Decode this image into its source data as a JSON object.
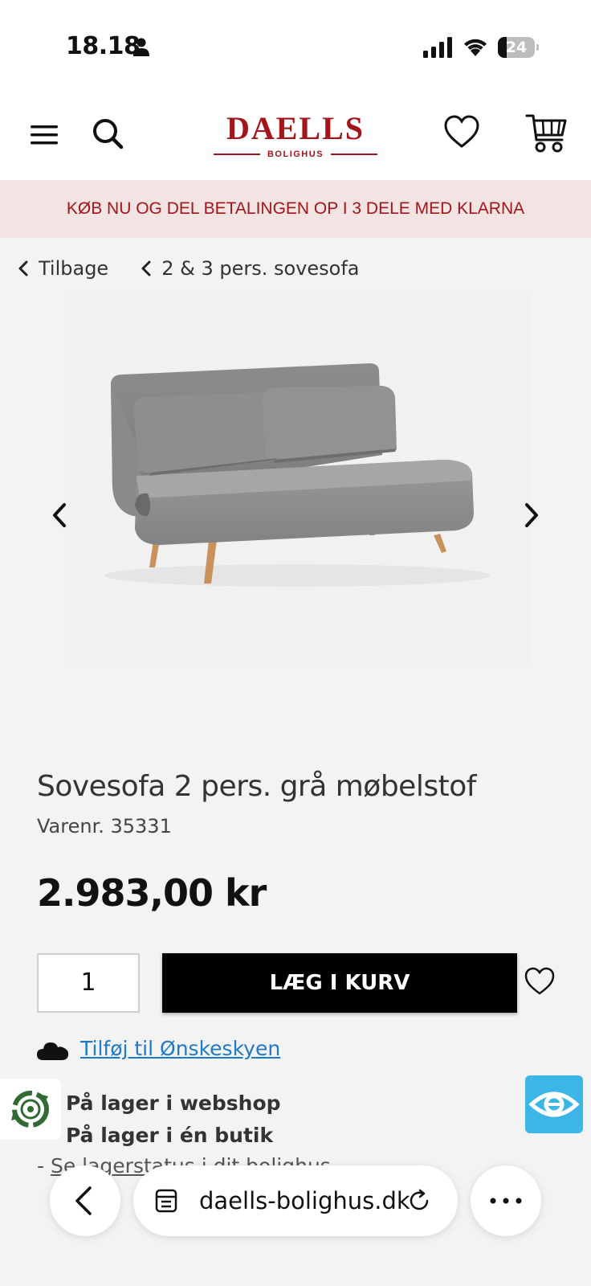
{
  "status_bar": {
    "time": "18.18",
    "battery": "24",
    "battery_level": 0.24
  },
  "header": {
    "brand_name": "DAELLS",
    "brand_sub": "BOLIGHUS"
  },
  "promo": {
    "text": "KØB NU OG DEL BETALINGEN OP I 3 DELE MED KLARNA"
  },
  "breadcrumb": {
    "back_label": "Tilbage",
    "category_label": "2 & 3 pers. sovesofa"
  },
  "product": {
    "title": "Sovesofa 2 pers. grå møbelstof",
    "sku": "Varenr. 35331",
    "price": "2.983,00 kr",
    "quantity": "1",
    "add_to_cart_label": "LÆG I KURV",
    "wishlist_link": "Tilføj til Ønskeskyen"
  },
  "stock": {
    "webshop": "På lager i webshop",
    "store": "På lager i én butik",
    "status_prefix": "- ",
    "status_link": "Se lagerstatus i dit bolighus"
  },
  "browser": {
    "url": "daells-bolighus.dk"
  },
  "colors": {
    "brand_red": "#a3151b",
    "promo_bg": "#f2e4e2",
    "link_blue": "#1e78c8",
    "badge_blue": "#3bb6e6"
  }
}
